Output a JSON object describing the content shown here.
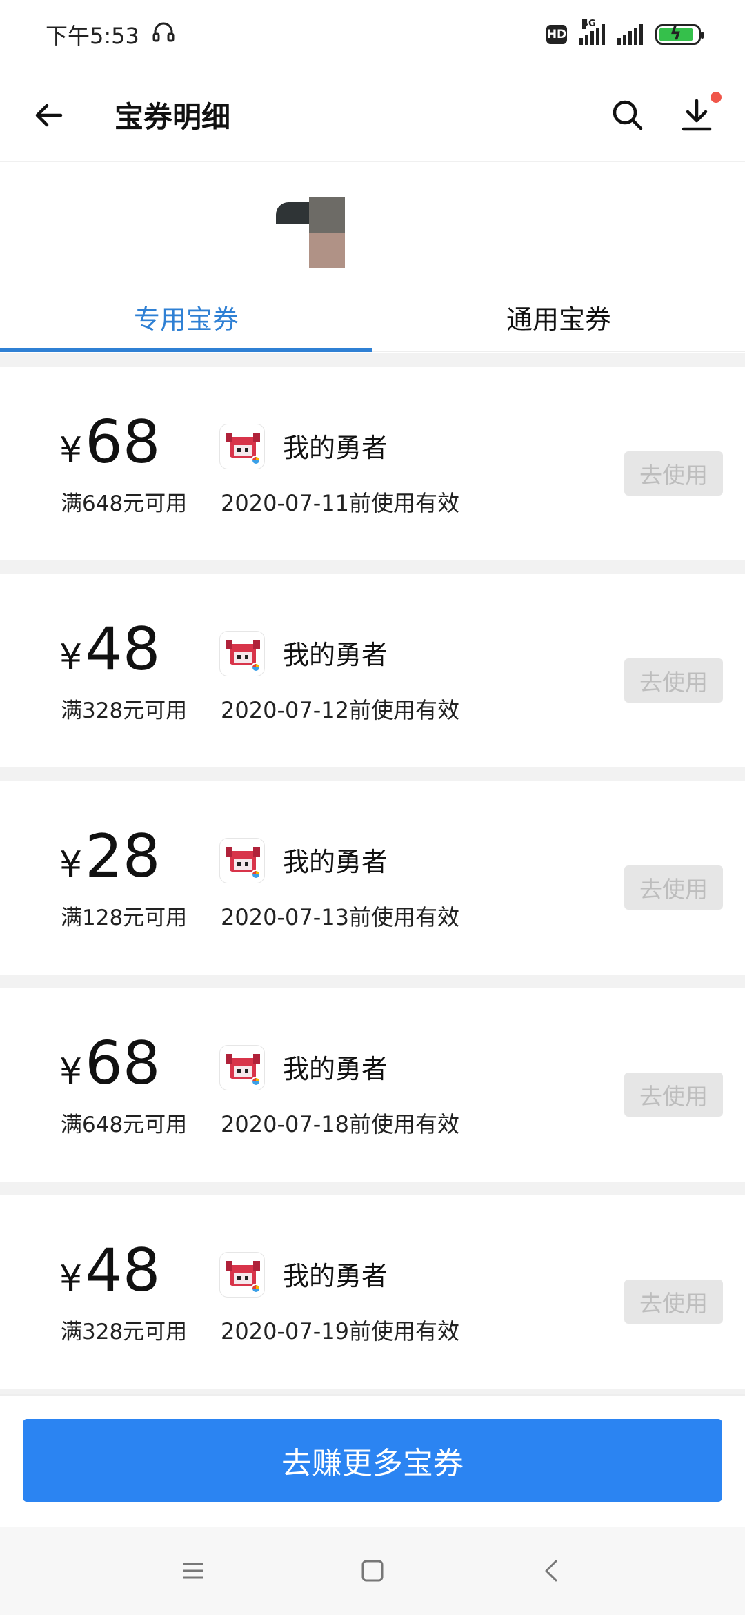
{
  "status_bar": {
    "time": "下午5:53",
    "hd": "HD",
    "network": "4G",
    "battery_level": 0.9
  },
  "header": {
    "title": "宝券明细"
  },
  "tabs": [
    {
      "label": "专用宝券",
      "active": true
    },
    {
      "label": "通用宝券",
      "active": false
    }
  ],
  "coupons": [
    {
      "currency": "¥",
      "amount": "68",
      "condition": "满648元可用",
      "game": "我的勇者",
      "validity": "2020-07-11前使用有效",
      "action": "去使用"
    },
    {
      "currency": "¥",
      "amount": "48",
      "condition": "满328元可用",
      "game": "我的勇者",
      "validity": "2020-07-12前使用有效",
      "action": "去使用"
    },
    {
      "currency": "¥",
      "amount": "28",
      "condition": "满128元可用",
      "game": "我的勇者",
      "validity": "2020-07-13前使用有效",
      "action": "去使用"
    },
    {
      "currency": "¥",
      "amount": "68",
      "condition": "满648元可用",
      "game": "我的勇者",
      "validity": "2020-07-18前使用有效",
      "action": "去使用"
    },
    {
      "currency": "¥",
      "amount": "48",
      "condition": "满328元可用",
      "game": "我的勇者",
      "validity": "2020-07-19前使用有效",
      "action": "去使用"
    }
  ],
  "bottom": {
    "earn_button": "去赚更多宝券"
  },
  "colors": {
    "accent": "#2f80d4",
    "button_primary": "#2b84f2",
    "disabled_bg": "#e6e6e6",
    "notification_dot": "#f0564a"
  },
  "icons": {
    "back": "arrow-left-icon",
    "search": "search-icon",
    "download": "download-icon",
    "headphone": "headphone-icon",
    "nav_menu": "menu-icon",
    "nav_home": "home-square-icon",
    "nav_back": "chevron-left-icon"
  }
}
